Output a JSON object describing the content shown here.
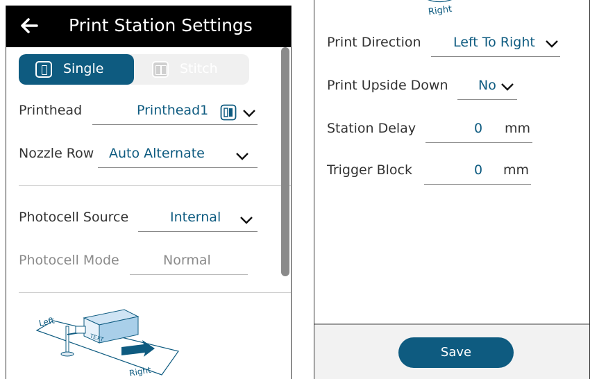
{
  "header": {
    "title": "Print Station Settings"
  },
  "mode_toggle": {
    "single_label": "Single",
    "stitch_label": "Stitch",
    "selected": "Single"
  },
  "left": {
    "printhead": {
      "label": "Printhead",
      "value": "Printhead1"
    },
    "nozzle_row": {
      "label": "Nozzle Row",
      "value": "Auto Alternate"
    },
    "photocell_source": {
      "label": "Photocell Source",
      "value": "Internal"
    },
    "photocell_mode": {
      "label": "Photocell Mode",
      "value": "Normal"
    },
    "illustration": {
      "left_text": "Left",
      "box_text": "TEXT",
      "right_text": "Right"
    }
  },
  "right": {
    "top_label": "Right",
    "print_direction": {
      "label": "Print Direction",
      "value": "Left To Right"
    },
    "print_upside_down": {
      "label": "Print Upside Down",
      "value": "No"
    },
    "station_delay": {
      "label": "Station Delay",
      "value": "0",
      "unit": "mm"
    },
    "trigger_block": {
      "label": "Trigger Block",
      "value": "0",
      "unit": "mm"
    },
    "save_label": "Save"
  },
  "colors": {
    "accent": "#0e5b80",
    "header_bg": "#000000",
    "disabled_text": "#8a8a8a"
  }
}
